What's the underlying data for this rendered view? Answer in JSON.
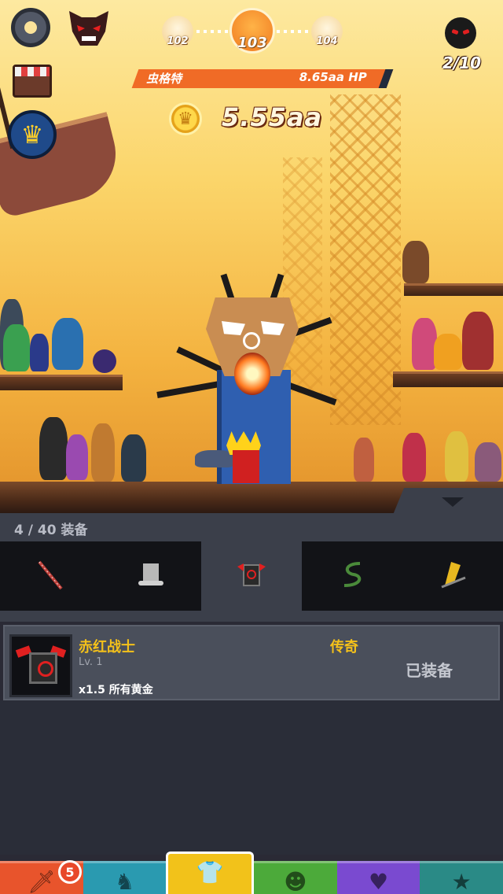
{
  "hud": {
    "stage_prev": "102",
    "stage_current": "103",
    "stage_next": "104",
    "kills": "2/10",
    "boss_name": "虫格特",
    "boss_hp": "8.65aa HP",
    "gold": "5.55aa"
  },
  "panel": {
    "count_label": "4 / 40 装备",
    "slots": [
      {
        "icon": "spear-icon"
      },
      {
        "icon": "top-hat-icon"
      },
      {
        "icon": "red-armor-icon"
      },
      {
        "icon": "serpent-icon"
      },
      {
        "icon": "golden-wing-sword-icon"
      }
    ],
    "active_slot": 2
  },
  "item": {
    "name": "赤红战士",
    "level": "Lv. 1",
    "rarity": "传奇",
    "effect": "x1.5 所有黄金",
    "status": "已装备"
  },
  "bottom_nav": {
    "badge_count": "5",
    "tabs": [
      {
        "icon": "sword-icon",
        "color": "#e8542c"
      },
      {
        "icon": "knight-helmet-icon",
        "color": "#2a9ab0"
      },
      {
        "icon": "shirt-icon",
        "color": "#f2c21a"
      },
      {
        "icon": "monster-icon",
        "color": "#4caa3a"
      },
      {
        "icon": "heart-icon",
        "color": "#7a4ad0"
      },
      {
        "icon": "star-icon",
        "color": "#2a8a86"
      }
    ],
    "active_tab": 2
  },
  "colors": {
    "hp_bar": "#f06b26",
    "gold_text_outline": "#6a2a10",
    "legendary": "#f4c11a",
    "panel_bg": "#3b3f4a"
  }
}
